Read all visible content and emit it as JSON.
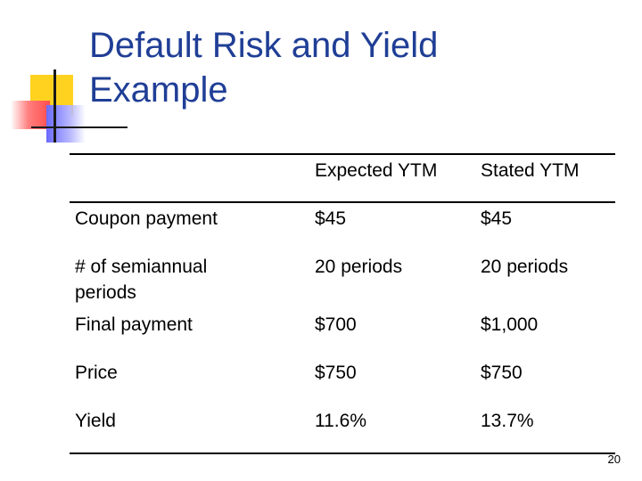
{
  "slide": {
    "title_line1": "Default Risk and Yield",
    "title_line2": "Example",
    "page_number": "20"
  },
  "table": {
    "headers": [
      "",
      "Expected YTM",
      "Stated YTM"
    ],
    "rows": [
      {
        "label_line1": "Coupon payment",
        "label_line2": "",
        "expected": "$45",
        "stated": "$45"
      },
      {
        "label_line1": "# of semiannual",
        "label_line2": "periods",
        "expected": "20 periods",
        "stated": "20 periods"
      },
      {
        "label_line1": "Final payment",
        "label_line2": "",
        "expected": "$700",
        "stated": "$1,000"
      },
      {
        "label_line1": "Price",
        "label_line2": "",
        "expected": "$750",
        "stated": "$750"
      },
      {
        "label_line1": "Yield",
        "label_line2": "",
        "expected": "11.6%",
        "stated": "13.7%"
      }
    ]
  },
  "colors": {
    "title": "#1f3e96",
    "deco_yellow": "#ffd21f",
    "deco_red": "#ff4d4d",
    "deco_blue": "#6a6aff"
  }
}
